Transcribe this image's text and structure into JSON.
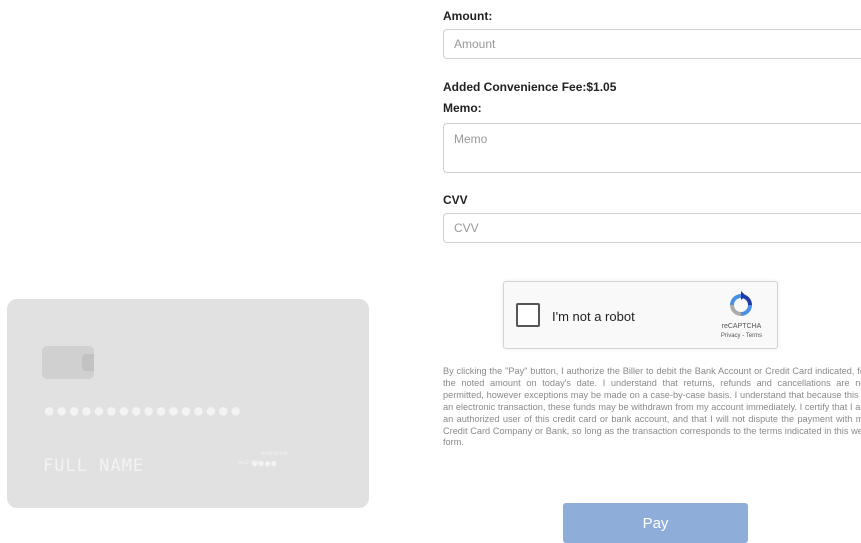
{
  "form": {
    "amount": {
      "label": "Amount:",
      "placeholder": "Amount",
      "value": ""
    },
    "convenience_fee": "Added Convenience Fee:$1.05",
    "memo": {
      "label": "Memo:",
      "placeholder": "Memo",
      "value": ""
    },
    "cvv": {
      "label": "CVV",
      "placeholder": "CVV",
      "value": ""
    }
  },
  "card": {
    "number": "●●●●●●●●●●●●●●●●",
    "name": "FULL NAME",
    "valid_thru_label": "MONTH/YEAR",
    "exp_label": "VALID THRU",
    "exp_value": "●●●●"
  },
  "recaptcha": {
    "checkbox_label": "I'm not a robot",
    "brand": "reCAPTCHA",
    "links": "Privacy - Terms",
    "checked": false
  },
  "disclaimer": "By clicking the \"Pay\" button, I authorize the Biller to debit the Bank Account or Credit Card indicated, for the noted amount on today's date. I understand that returns, refunds and cancellations are not permitted, however exceptions may be made on a case-by-case basis. I understand that because this is an electronic transaction, these funds may be withdrawn from my account immediately. I certify that I am an authorized user of this credit card or bank account, and that I will not dispute the payment with my Credit Card Company or Bank, so long as the transaction corresponds to the terms indicated in this web form.",
  "pay_button": {
    "label": "Pay",
    "color": "#8fadd9"
  }
}
